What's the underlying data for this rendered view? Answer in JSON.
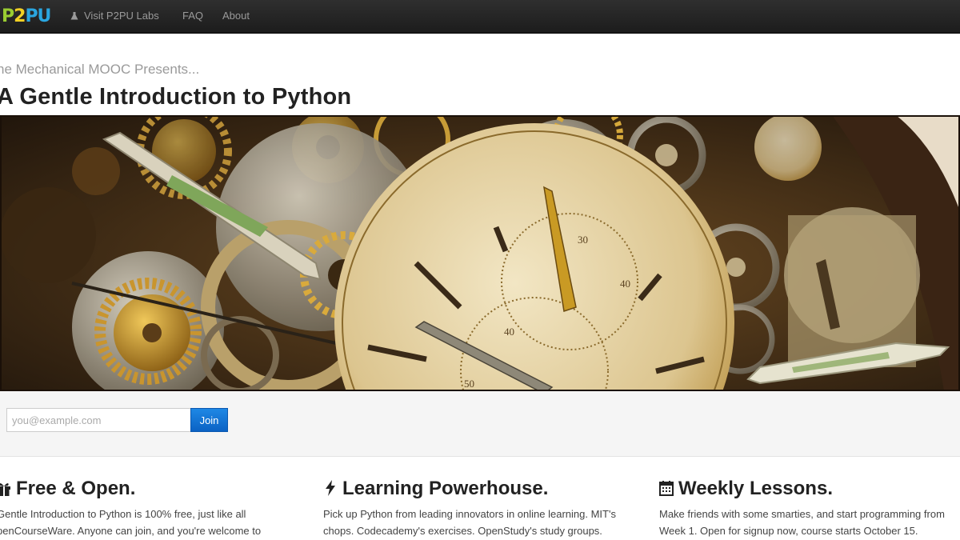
{
  "navbar": {
    "brand": [
      "P",
      "2",
      "PU"
    ],
    "items": [
      {
        "label": "Visit P2PU Labs",
        "icon": "flask-icon"
      },
      {
        "label": "FAQ"
      },
      {
        "label": "About"
      }
    ]
  },
  "header": {
    "presents": "he Mechanical MOOC Presents...",
    "title": "A Gentle Introduction to Python"
  },
  "hero": {
    "image": "clockwork-gears-photo"
  },
  "signup": {
    "email_placeholder": "you@example.com",
    "join_label": "Join"
  },
  "features": [
    {
      "icon": "gift-icon",
      "title": "Free & Open.",
      "text": "Gentle Introduction to Python is 100% free, just like all penCourseWare. Anyone can join, and you're welcome to"
    },
    {
      "icon": "bolt-icon",
      "title": "Learning Powerhouse.",
      "text": "Pick up Python from leading innovators in online learning. MIT's chops. Codecademy's exercises. OpenStudy's study groups."
    },
    {
      "icon": "calendar-icon",
      "title": "Weekly Lessons.",
      "text": "Make friends with some smarties, and start programming from Week 1. Open for signup now, course starts October 15."
    }
  ],
  "colors": {
    "navbar": "#1c1c1c",
    "nav_text": "#9a9a9a",
    "join_button": "#0b62c4",
    "signup_bg": "#f5f5f5"
  }
}
